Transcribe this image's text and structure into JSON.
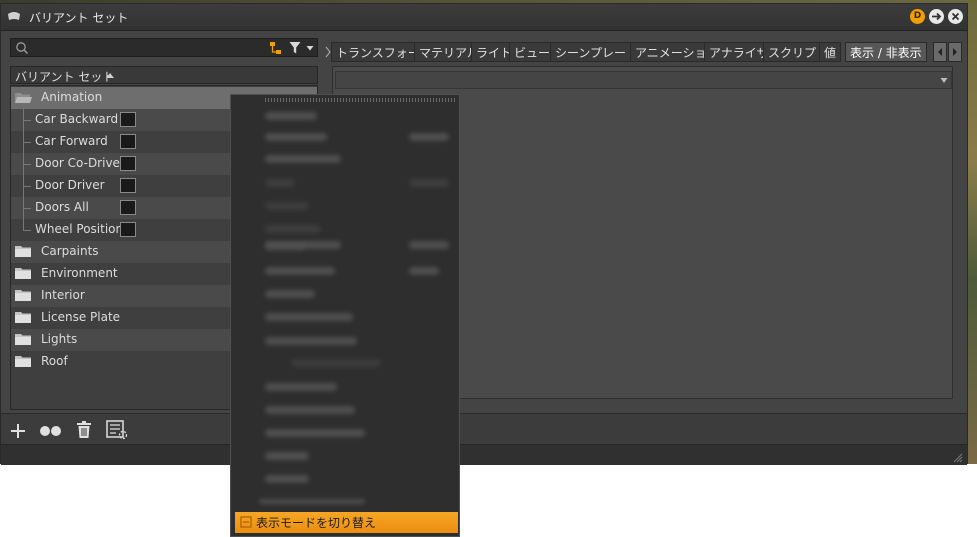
{
  "window": {
    "title": "バリアント セット"
  },
  "left_panel": {
    "header_label": "バリアント セット",
    "search": {
      "value": "",
      "placeholder": ""
    },
    "groups": [
      {
        "label": "Animation",
        "selected": true,
        "expanded": true,
        "children": [
          "Car Backward",
          "Car Forward",
          "Door Co-Driver",
          "Door Driver",
          "Doors All",
          "Wheel Position"
        ]
      },
      {
        "label": "Carpaints"
      },
      {
        "label": "Environment"
      },
      {
        "label": "Interior"
      },
      {
        "label": "License Plate"
      },
      {
        "label": "Lights"
      },
      {
        "label": "Roof"
      }
    ]
  },
  "tabs": [
    "トランスフォーム",
    "マテリアル",
    "ライト",
    "ビュー",
    "シーンプレート",
    "アニメーション",
    "アナライザ",
    "スクリプト",
    "値",
    "表示 / 非表示"
  ],
  "active_tab": "表示 / 非表示",
  "context_menu": {
    "highlighted_item": "表示モードを切り替え"
  },
  "colors": {
    "accent": "#f0a000",
    "menu_highlight": "#f29a1c",
    "window_bg": "#444444"
  }
}
